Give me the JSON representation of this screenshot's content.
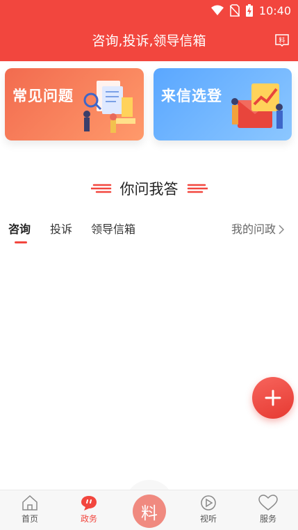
{
  "status": {
    "time": "10:40"
  },
  "header": {
    "title": "咨询,投诉,领导信箱",
    "action_icon": "stamp-book-icon"
  },
  "cards": [
    {
      "title": "常见问题",
      "color": "#f26b4f"
    },
    {
      "title": "来信选登",
      "color": "#5aa7ff"
    }
  ],
  "section": {
    "title": "你问我答"
  },
  "tabs": [
    {
      "label": "咨询",
      "active": true
    },
    {
      "label": "投诉",
      "active": false
    },
    {
      "label": "领导信箱",
      "active": false
    }
  ],
  "my_link": {
    "label": "我的问政"
  },
  "bottom_nav": [
    {
      "label": "首页",
      "icon": "home-icon"
    },
    {
      "label": "政务",
      "icon": "chat-bubble-icon",
      "active": true
    },
    {
      "label": "",
      "icon": "center-logo-icon"
    },
    {
      "label": "视听",
      "icon": "play-icon"
    },
    {
      "label": "服务",
      "icon": "heart-icon"
    }
  ],
  "colors": {
    "brand": "#f2463e",
    "tabbar_bg": "#f7f7f7"
  }
}
